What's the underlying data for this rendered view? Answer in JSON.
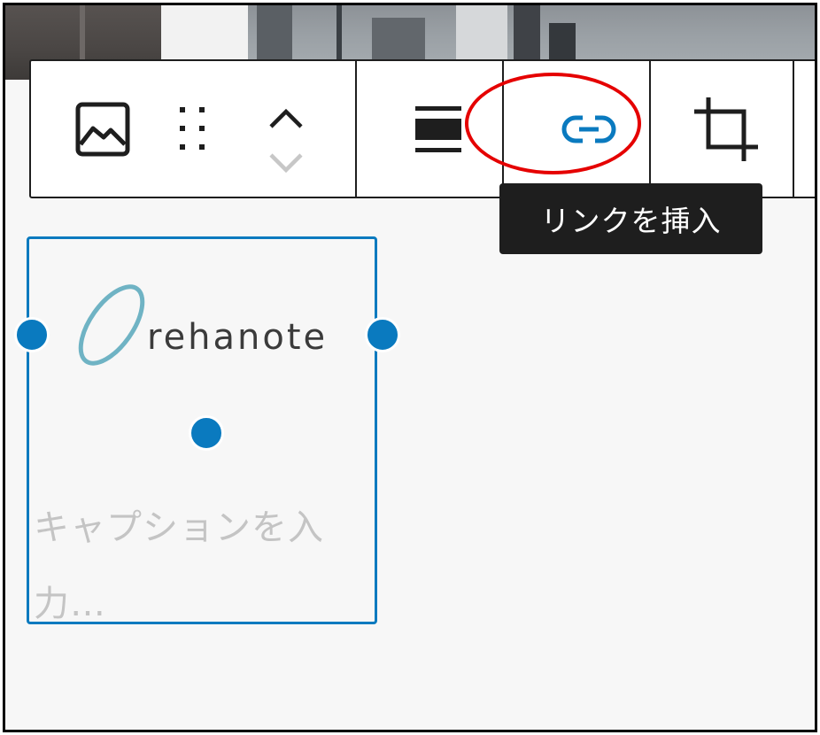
{
  "toolbar": {
    "buttons": [
      {
        "name": "image-icon",
        "label": ""
      },
      {
        "name": "drag-handle-icon",
        "label": ""
      },
      {
        "name": "move-up-icon",
        "label": ""
      },
      {
        "name": "move-down-icon",
        "label": ""
      },
      {
        "name": "align-icon",
        "label": ""
      },
      {
        "name": "link-icon",
        "label": ""
      },
      {
        "name": "crop-icon",
        "label": ""
      }
    ]
  },
  "tooltip": {
    "text": "リンクを挿入"
  },
  "image_block": {
    "logo_text": "rehanote",
    "caption_placeholder": "キャプションを入力…"
  },
  "colors": {
    "accent": "#0a7abf",
    "highlight": "#e50000",
    "tooltip_bg": "#1e1e1e",
    "logo_swirl": "#6fb3c4"
  }
}
